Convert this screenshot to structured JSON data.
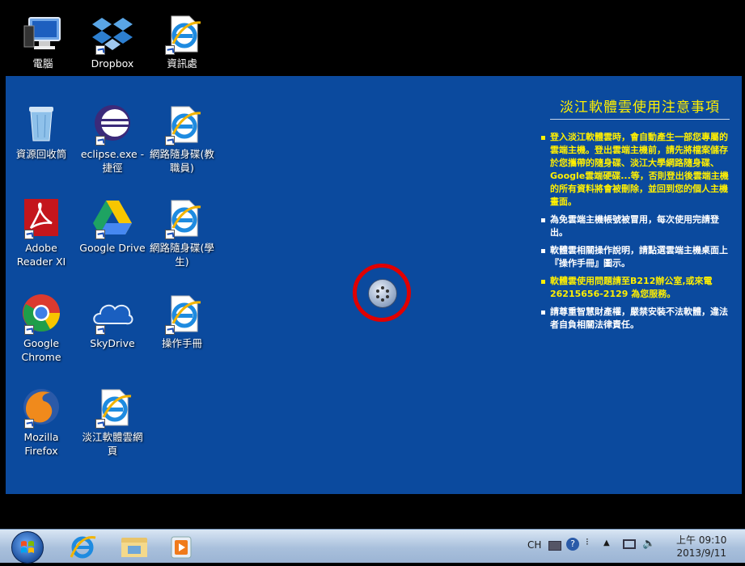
{
  "desktop_icons": [
    {
      "label": "電腦",
      "icon": "computer-icon"
    },
    {
      "label": "Dropbox",
      "icon": "dropbox-icon"
    },
    {
      "label": "資訊處",
      "icon": "ie-shortcut-icon"
    },
    {
      "label": "資源回收筒",
      "icon": "recycle-bin-icon"
    },
    {
      "label": "eclipse.exe - 捷徑",
      "icon": "eclipse-icon"
    },
    {
      "label": "網路隨身碟(教職員)",
      "icon": "ie-shortcut-icon"
    },
    {
      "label": "Adobe Reader XI",
      "icon": "adobe-reader-icon"
    },
    {
      "label": "Google Drive",
      "icon": "google-drive-icon"
    },
    {
      "label": "網路隨身碟(學生)",
      "icon": "ie-shortcut-icon"
    },
    {
      "label": "Google Chrome",
      "icon": "chrome-icon"
    },
    {
      "label": "SkyDrive",
      "icon": "skydrive-icon"
    },
    {
      "label": "操作手冊",
      "icon": "ie-shortcut-icon"
    },
    {
      "label": "Mozilla Firefox",
      "icon": "firefox-icon"
    },
    {
      "label": "淡江軟體雲網頁",
      "icon": "ie-shortcut-icon"
    }
  ],
  "notice": {
    "title": "淡江軟體雲使用注意事項",
    "items": [
      "登入淡江軟體雲時，會自動產生一部您專屬的雲端主機。登出雲端主機前，請先將檔案儲存於您攜帶的隨身碟、淡江大學網路隨身碟、Google雲端硬碟...等，否則登出後雲端主機的所有資料將會被刪除，並回到您的個人主機畫面。",
      "為免雲端主機帳號被冒用，每次使用完請登出。",
      "軟體雲相關操作說明，請點選雲端主機桌面上『操作手冊』圖示。",
      "軟體雲使用問題請至B212辦公室,或來電26215656-2129 為您服務。",
      "請尊重智慧財產權，嚴禁安裝不法軟體，違法者自負相關法律責任。"
    ]
  },
  "taskbar": {
    "pinned": [
      "start-button",
      "internet-explorer",
      "file-explorer",
      "media-player"
    ],
    "tray": {
      "language": "CH",
      "clock_time": "上午 09:10",
      "clock_date": "2013/9/11"
    }
  },
  "colors": {
    "desktop_bg": "#0b4a9e",
    "notice_text": "#ffef00",
    "highlight_ring": "#e00000"
  }
}
